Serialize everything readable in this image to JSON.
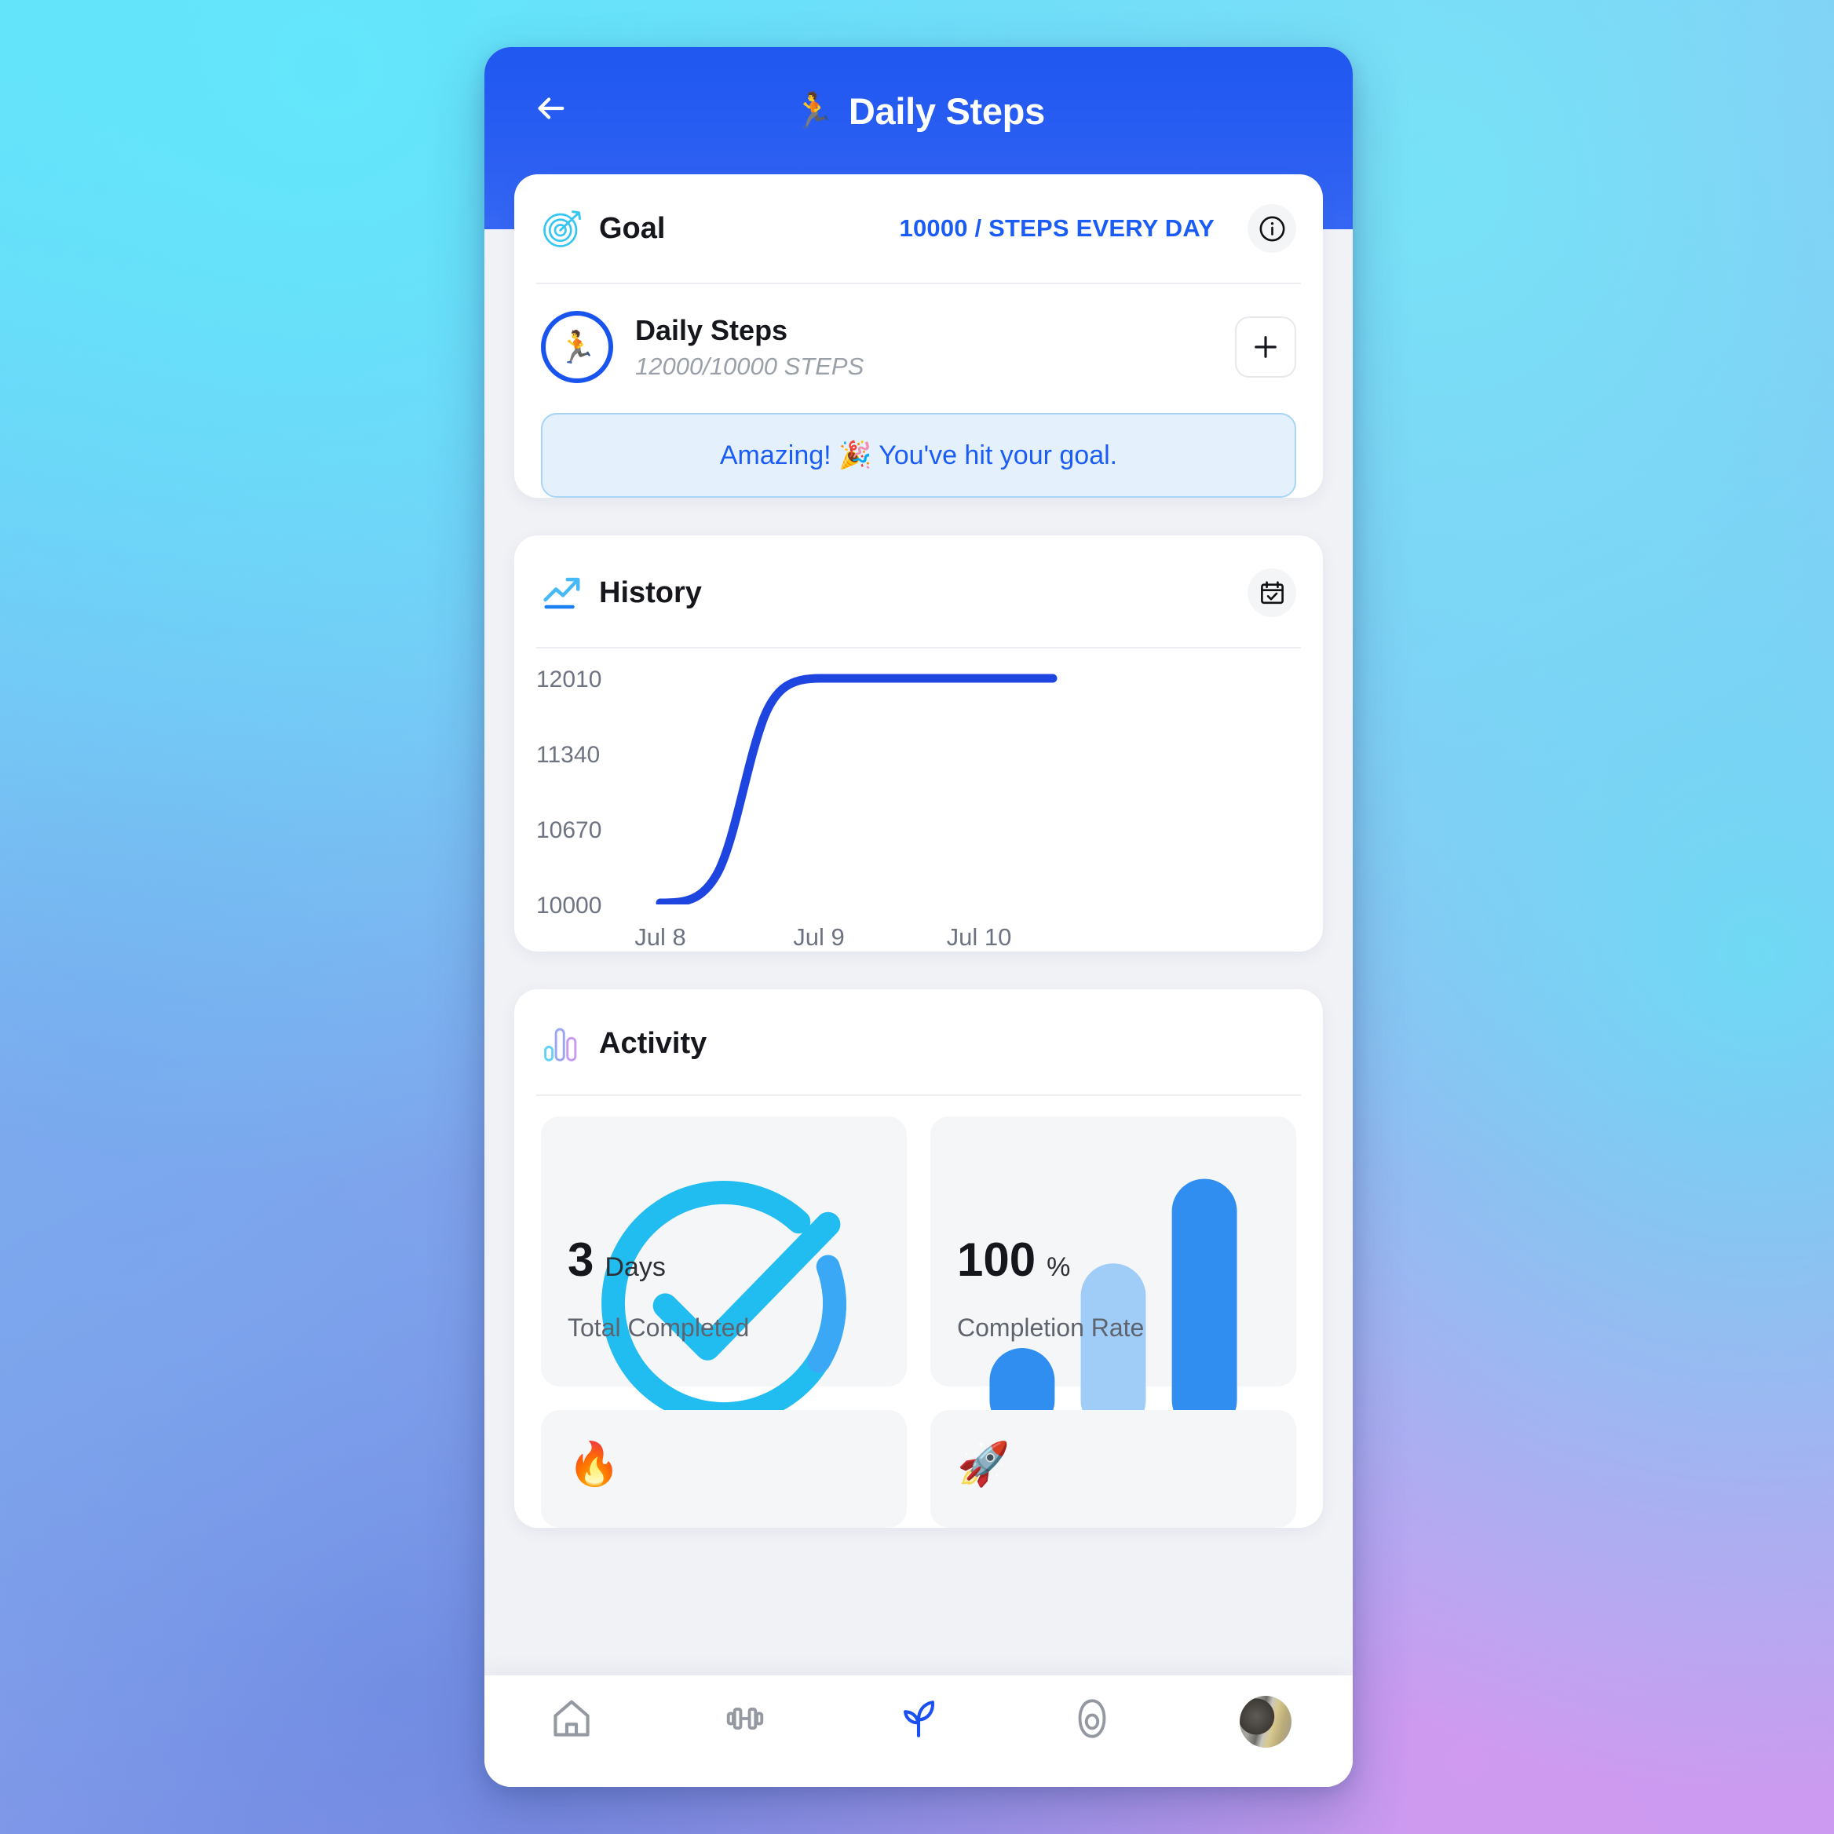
{
  "header": {
    "back_icon": "arrow-left-icon",
    "emoji": "🏃",
    "title": "Daily Steps"
  },
  "goal": {
    "icon": "target-icon",
    "label": "Goal",
    "value": "10000 / STEPS EVERY DAY",
    "info_icon": "info-icon",
    "habit": {
      "avatar_emoji": "🏃",
      "name": "Daily Steps",
      "progress": "12000/10000 STEPS",
      "add_icon": "plus-icon"
    },
    "banner": "Amazing! 🎉 You've hit your goal."
  },
  "history": {
    "icon": "trending-up-icon",
    "title": "History",
    "calendar_icon": "calendar-check-icon"
  },
  "activity": {
    "icon": "bar-chart-icon",
    "title": "Activity",
    "stats": [
      {
        "icon": "check-circle-icon",
        "value": "3",
        "unit": "Days",
        "label": "Total Completed"
      },
      {
        "icon": "bar-chart-solid-icon",
        "value": "100",
        "unit": "%",
        "label": "Completion Rate"
      }
    ],
    "stats_partial": [
      {
        "icon": "flame-icon",
        "emoji": "🔥"
      },
      {
        "icon": "rocket-icon",
        "emoji": "🚀"
      }
    ]
  },
  "nav": {
    "items": [
      {
        "icon": "home-icon",
        "active": false
      },
      {
        "icon": "dumbbell-icon",
        "active": false
      },
      {
        "icon": "sprout-icon",
        "active": true
      },
      {
        "icon": "avocado-icon",
        "active": false
      },
      {
        "icon": "profile-avatar",
        "active": false
      }
    ]
  },
  "colors": {
    "header_blue": "#2a5ef2",
    "accent_blue": "#1a5cf5",
    "chart_line": "#1f45e0",
    "cyan": "#29b6f6",
    "banner_bg": "#e4f1fd",
    "banner_border": "#a8d5f5"
  },
  "chart_data": {
    "type": "line",
    "title": "History",
    "x": [
      "Jul 8",
      "Jul 9",
      "Jul 10"
    ],
    "categories": [
      "Jul 8",
      "Jul 9",
      "Jul 10"
    ],
    "values": [
      10000,
      12010,
      12010
    ],
    "series": [
      {
        "name": "Daily Steps",
        "values": [
          10000,
          12010,
          12010
        ]
      }
    ],
    "ytick_labels": [
      "12010",
      "11340",
      "10670",
      "10000"
    ],
    "yticks": [
      12010,
      11340,
      10670,
      10000
    ],
    "ylim": [
      10000,
      12010
    ],
    "xlabel": "",
    "ylabel": "",
    "grid": false,
    "legend": false,
    "line_color": "#1f45e0",
    "smoothing": "spline"
  }
}
